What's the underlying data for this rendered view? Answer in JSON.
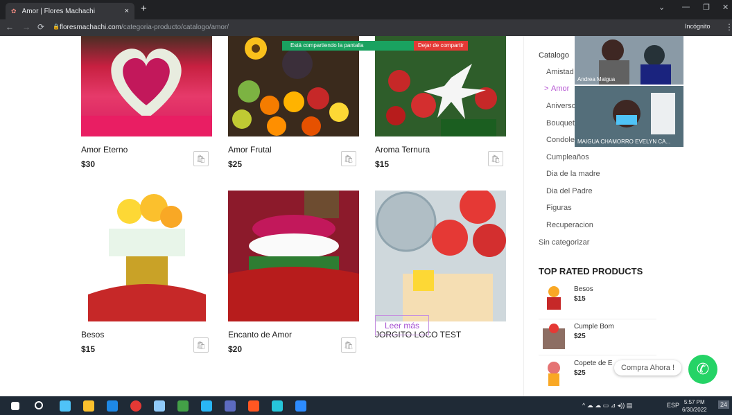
{
  "browser": {
    "tab_title": "Amor | Flores Machachi",
    "tab_close": "×",
    "new_tab": "+",
    "url_host": "floresmachachi.com",
    "url_path": "/categoria-producto/catalogo/amor/",
    "incognito_label": "Incógnito"
  },
  "share_bar": {
    "sharing_text": "Está compartiendo la pantalla",
    "stop_text": "Dejar de compartir"
  },
  "products": [
    {
      "name": "Amor Eterno",
      "price": "$30"
    },
    {
      "name": "Amor Frutal",
      "price": "$25"
    },
    {
      "name": "Aroma Ternura",
      "price": "$15"
    },
    {
      "name": "Besos",
      "price": "$15"
    },
    {
      "name": "Encanto de Amor",
      "price": "$20"
    },
    {
      "name": "JORGITO LOCO TEST",
      "price": ""
    }
  ],
  "leer_mas": "Leer más",
  "sidebar": {
    "catalogo": "Catalogo",
    "categories": [
      "Amistad",
      "Amor",
      "Aniverso",
      "Bouquet",
      "Condole",
      "Cumpleaños",
      "Dia de la madre",
      "Dia del Padre",
      "Figuras",
      "Recuperacion"
    ],
    "active_marker": ">",
    "sin_categorizar": "Sin categorizar",
    "top_rated_title": "TOP RATED PRODUCTS",
    "top_rated": [
      {
        "name": "Besos",
        "price": "$15"
      },
      {
        "name": "Cumple Bom",
        "price": "$25"
      },
      {
        "name": "Copete de E",
        "price": "$25"
      }
    ]
  },
  "video_call": {
    "participant1": "Andrea Maigua",
    "participant2": "MAIGUA CHAMORRO EVELYN CA..."
  },
  "whatsapp": {
    "label": "Compra Ahora !"
  },
  "taskbar": {
    "lang": "ESP",
    "time": "5:57 PM",
    "date": "6/30/2022",
    "notif": "24"
  },
  "colors": {
    "accent": "#b34fd1",
    "whatsapp": "#25d366"
  }
}
